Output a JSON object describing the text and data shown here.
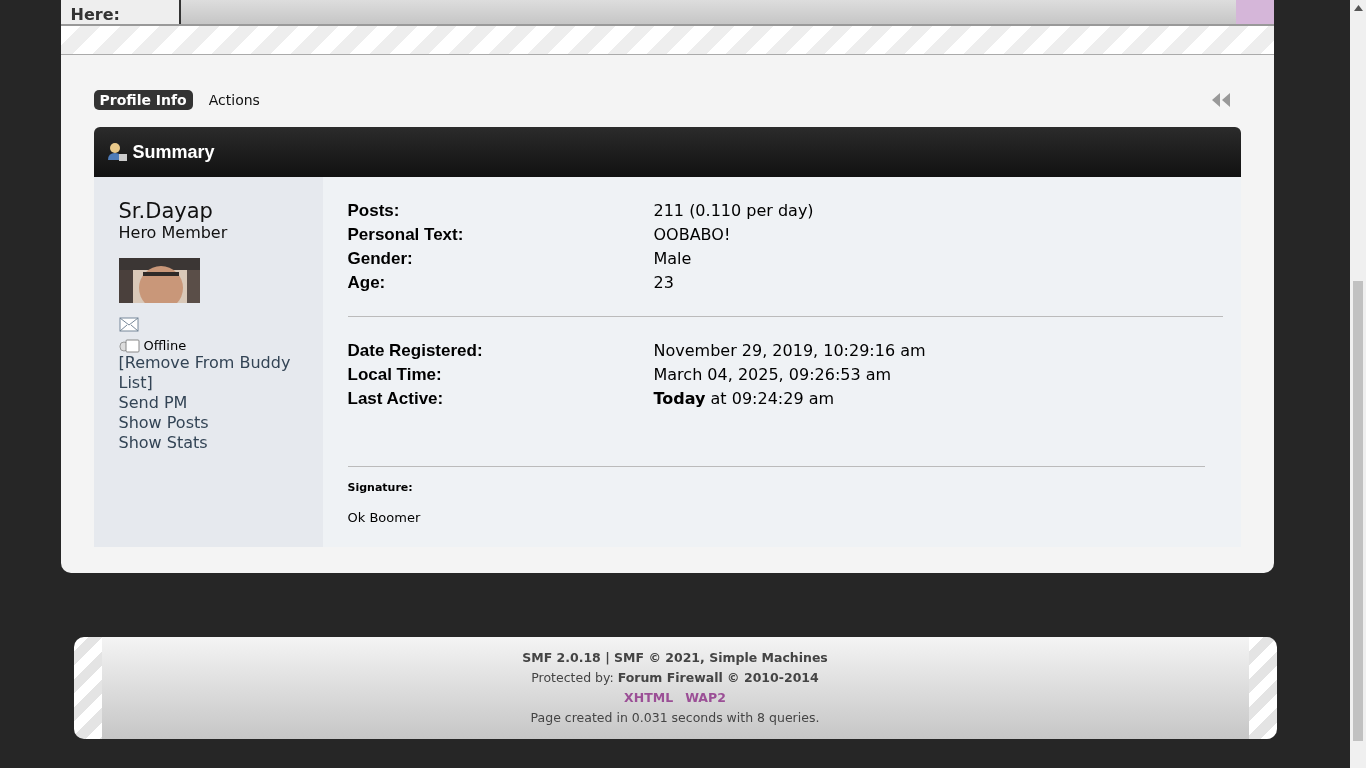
{
  "breadcrumb": {
    "label": "Here:"
  },
  "tabs": [
    {
      "label": "Profile Info",
      "selected": true
    },
    {
      "label": "Actions",
      "selected": false
    }
  ],
  "summary": {
    "title": "Summary",
    "member": {
      "name": "Sr.Dayap",
      "rank": "Hero Member",
      "status": "Offline",
      "online": false,
      "links": [
        "[Remove From Buddy List]",
        "Send PM",
        "Show Posts",
        "Show Stats"
      ]
    },
    "groups": [
      [
        {
          "label": "Posts:",
          "value": "211 (0.110 per day)"
        },
        {
          "label": "Personal Text:",
          "value": "OOBABO!"
        },
        {
          "label": "Gender:",
          "value": "Male"
        },
        {
          "label": "Age:",
          "value": "23"
        }
      ],
      [
        {
          "label": "Date Registered:",
          "value": "November 29, 2019, 10:29:16 am"
        },
        {
          "label": "Local Time:",
          "value": "March 04, 2025, 09:26:53 am"
        },
        {
          "label": "Last Active:",
          "value": "**Today** at 09:24:29 am"
        }
      ]
    ],
    "signature": {
      "label": "Signature:",
      "text": "Ok Boomer"
    }
  },
  "footer": {
    "lines": [
      "SMF 2.0.18 | SMF © 2021, Simple Machines",
      "Protected by: **Forum Firewall © 2010-2014**"
    ],
    "links": [
      "XHTML",
      "WAP2"
    ],
    "note": "Page created in 0.031 seconds with 8 queries."
  }
}
